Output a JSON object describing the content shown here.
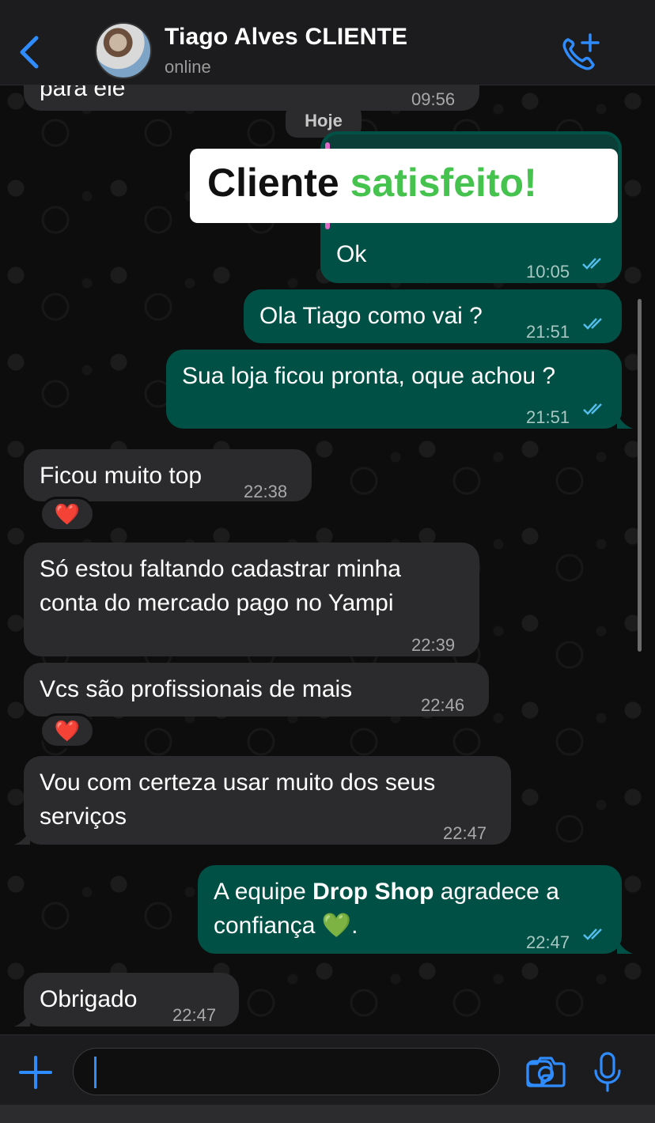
{
  "header": {
    "contact_name": "Tiago Alves CLIENTE",
    "status": "online",
    "accent": "#2f8cff"
  },
  "chat": {
    "day_label": "Hoje",
    "banner": {
      "part1": "Cliente ",
      "part2": "satisfeito!"
    },
    "messages": [
      {
        "dir": "in",
        "text": "para ele",
        "time": "09:56"
      },
      {
        "dir": "out",
        "text": "Ok",
        "time": "10:05",
        "read": true
      },
      {
        "dir": "out",
        "text": "Ola Tiago como vai ?",
        "time": "21:51",
        "read": true
      },
      {
        "dir": "out",
        "text": "Sua loja ficou pronta, oque achou ?",
        "time": "21:51",
        "read": true
      },
      {
        "dir": "in",
        "text": "Ficou muito top",
        "time": "22:38",
        "reaction": "❤️"
      },
      {
        "dir": "in",
        "line1": "Só estou faltando cadastrar minha",
        "line2": "conta do mercado pago no Yampi",
        "time": "22:39"
      },
      {
        "dir": "in",
        "text": "Vcs são profissionais de mais",
        "time": "22:46",
        "reaction": "❤️"
      },
      {
        "dir": "in",
        "line1": "Vou com certeza usar muito dos seus",
        "line2": "serviços",
        "time": "22:47"
      },
      {
        "dir": "out",
        "pre": "A equipe ",
        "bold": "Drop Shop",
        "post": " agradece a",
        "line2": "confiança ",
        "emoji": "💚",
        "line2_end": ".",
        "time": "22:47",
        "read": true
      },
      {
        "dir": "in",
        "text": "Obrigado",
        "time": "22:47"
      }
    ]
  },
  "colors": {
    "incoming": "#2b2b2d",
    "outgoing": "#005046",
    "read_ticks": "#53bdeb",
    "banner_green": "#45c34e"
  }
}
